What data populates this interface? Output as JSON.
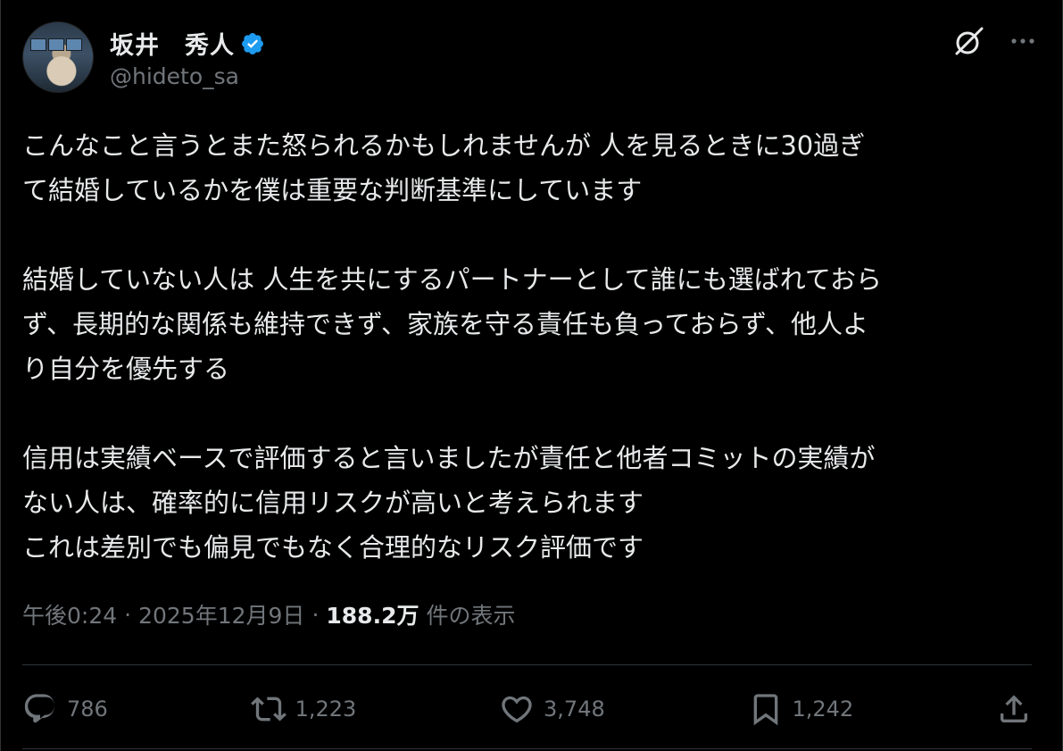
{
  "author": {
    "display_name": "坂井　秀人",
    "handle": "@hideto_sa",
    "verified": true
  },
  "icons": {
    "verified": "verified-badge-icon",
    "grok": "grok-icon",
    "more": "more-options-icon",
    "reply": "reply-icon",
    "repost": "repost-icon",
    "like": "like-icon",
    "bookmark": "bookmark-icon",
    "share": "share-icon"
  },
  "tweet": {
    "paragraphs": [
      "こんなこと言うとまた怒られるかもしれませんが 人を見るときに30過ぎ\nて結婚しているかを僕は重要な判断基準にしています",
      "結婚していない人は 人生を共にするパートナーとして誰にも選ばれておら\nず、長期的な関係も維持できず、家族を守る責任も負っておらず、他人よ\nり自分を優先する",
      "信用は実績ベースで評価すると言いましたが責任と他者コミットの実績が\nない人は、確率的に信用リスクが高いと考えられます\nこれは差別でも偏見でもなく合理的なリスク評価です"
    ]
  },
  "meta": {
    "time": "午後0:24",
    "date": "2025年12月9日",
    "separator": "·",
    "views_count": "188.2万",
    "views_label": "件の表示"
  },
  "stats": {
    "replies": "786",
    "reposts": "1,223",
    "likes": "3,748",
    "bookmarks": "1,242"
  },
  "colors": {
    "background": "#000000",
    "text": "#e7e9ea",
    "secondary": "#71767b",
    "verified": "#1d9bf0",
    "divider": "#2f3336"
  }
}
